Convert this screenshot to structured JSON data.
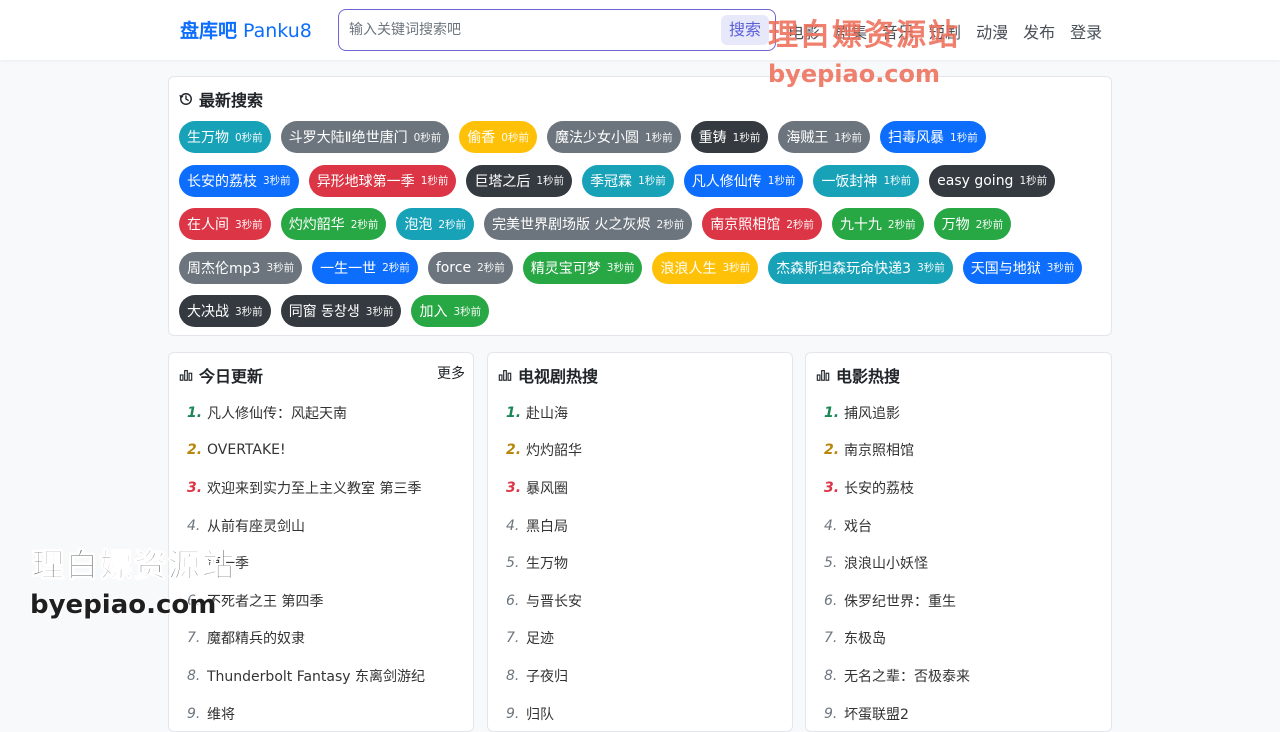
{
  "header": {
    "brand_cn": "盘库吧",
    "brand_en": "Panku8",
    "search_placeholder": "输入关键词搜索吧",
    "search_button": "搜索",
    "nav": [
      "电影",
      "剧集",
      "音乐",
      "短剧",
      "动漫",
      "发布",
      "登录"
    ]
  },
  "watermark": {
    "cn": "理白嫖资源站",
    "url": "byepiao.com"
  },
  "recent": {
    "title": "最新搜索",
    "rows": [
      [
        {
          "label": "生万物",
          "time": "0秒前",
          "color": "#17a2b8"
        },
        {
          "label": "斗罗大陆Ⅱ绝世唐门",
          "time": "0秒前",
          "color": "#6c757d"
        },
        {
          "label": "偷香",
          "time": "0秒前",
          "color": "#ffc107"
        },
        {
          "label": "魔法少女小圆",
          "time": "1秒前",
          "color": "#6c757d"
        },
        {
          "label": "重铸",
          "time": "1秒前",
          "color": "#343a40"
        },
        {
          "label": "海贼王",
          "time": "1秒前",
          "color": "#6c757d"
        },
        {
          "label": "扫毒风暴",
          "time": "1秒前",
          "color": "#0d6efd"
        }
      ],
      [
        {
          "label": "长安的荔枝",
          "time": "3秒前",
          "color": "#0d6efd"
        },
        {
          "label": "异形地球第一季",
          "time": "1秒前",
          "color": "#dc3545"
        },
        {
          "label": "巨塔之后",
          "time": "1秒前",
          "color": "#343a40"
        },
        {
          "label": "季冠霖",
          "time": "1秒前",
          "color": "#17a2b8"
        },
        {
          "label": "凡人修仙传",
          "time": "1秒前",
          "color": "#0d6efd"
        },
        {
          "label": "一饭封神",
          "time": "1秒前",
          "color": "#17a2b8"
        },
        {
          "label": "easy going",
          "time": "1秒前",
          "color": "#343a40"
        }
      ],
      [
        {
          "label": "在人间",
          "time": "3秒前",
          "color": "#dc3545"
        },
        {
          "label": "灼灼韶华",
          "time": "2秒前",
          "color": "#28a745"
        },
        {
          "label": "泡泡",
          "time": "2秒前",
          "color": "#17a2b8"
        },
        {
          "label": "完美世界剧场版 火之灰烬",
          "time": "2秒前",
          "color": "#6c757d"
        },
        {
          "label": "南京照相馆",
          "time": "2秒前",
          "color": "#dc3545"
        },
        {
          "label": "九十九",
          "time": "2秒前",
          "color": "#28a745"
        },
        {
          "label": "万物",
          "time": "2秒前",
          "color": "#28a745"
        }
      ],
      [
        {
          "label": "周杰伦mp3",
          "time": "3秒前",
          "color": "#6c757d"
        },
        {
          "label": "一生一世",
          "time": "2秒前",
          "color": "#0d6efd"
        },
        {
          "label": "force",
          "time": "2秒前",
          "color": "#6c757d"
        },
        {
          "label": "精灵宝可梦",
          "time": "3秒前",
          "color": "#28a745"
        },
        {
          "label": "浪浪人生",
          "time": "3秒前",
          "color": "#ffc107"
        },
        {
          "label": "杰森斯坦森玩命快递3",
          "time": "3秒前",
          "color": "#17a2b8"
        },
        {
          "label": "天国与地狱",
          "time": "3秒前",
          "color": "#0d6efd"
        }
      ],
      [
        {
          "label": "大决战",
          "time": "3秒前",
          "color": "#343a40"
        },
        {
          "label": "同窗 동창생",
          "time": "3秒前",
          "color": "#343a40"
        },
        {
          "label": "加入",
          "time": "3秒前",
          "color": "#28a745"
        }
      ]
    ]
  },
  "lists": [
    {
      "title": "今日更新",
      "more": "更多",
      "items": [
        "凡人修仙传：风起天南",
        "OVERTAKE!",
        "欢迎来到实力至上主义教室 第三季",
        "从前有座灵剑山",
        "第一季",
        "不死者之王 第四季",
        "魔都精兵的奴隶",
        "Thunderbolt Fantasy 东离剑游纪",
        "维将"
      ]
    },
    {
      "title": "电视剧热搜",
      "more": "",
      "items": [
        "赴山海",
        "灼灼韶华",
        "暴风圈",
        "黑白局",
        "生万物",
        "与晋长安",
        "足迹",
        "子夜归",
        "归队"
      ]
    },
    {
      "title": "电影热搜",
      "more": "",
      "items": [
        "捕风追影",
        "南京照相馆",
        "长安的荔枝",
        "戏台",
        "浪浪山小妖怪",
        "侏罗纪世界：重生",
        "东极岛",
        "无名之辈：否极泰来",
        "坏蛋联盟2"
      ]
    }
  ]
}
